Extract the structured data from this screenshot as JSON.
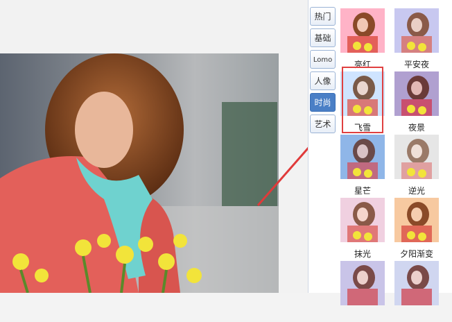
{
  "tabs": [
    {
      "label": "热门",
      "active": false
    },
    {
      "label": "基础",
      "active": false
    },
    {
      "label": "Lomo",
      "active": false
    },
    {
      "label": "人像",
      "active": false
    },
    {
      "label": "时尚",
      "active": true
    },
    {
      "label": "艺术",
      "active": false
    }
  ],
  "filters": [
    {
      "label": "亮红",
      "tint": "#ffb3c7"
    },
    {
      "label": "平安夜",
      "tint": "#c8c8f0"
    },
    {
      "label": "飞雪",
      "tint": "#cfe4ff"
    },
    {
      "label": "夜景",
      "tint": "#b0a0d0"
    },
    {
      "label": "星芒",
      "tint": "#8fb6e8"
    },
    {
      "label": "逆光",
      "tint": "#e6e6e6"
    },
    {
      "label": "抹光",
      "tint": "#f0d0e0"
    },
    {
      "label": "夕阳渐变",
      "tint": "#f7c9a0"
    },
    {
      "label": "",
      "tint": "#c9c4e8"
    },
    {
      "label": "",
      "tint": "#d0d6f0"
    }
  ],
  "colors": {
    "accent": "#4a7fc6",
    "highlight": "#e04040"
  }
}
